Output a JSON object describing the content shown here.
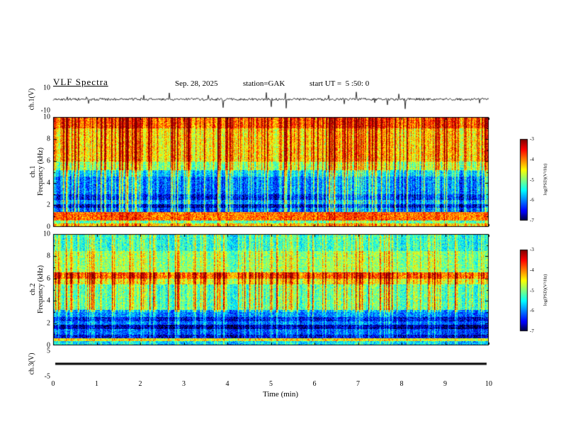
{
  "header": {
    "title": "VLF Spectra",
    "date": "Sep. 28, 2025",
    "station": "station=GAK",
    "start_ut": "start UT =  5 :50: 0"
  },
  "chart_data": {
    "type": "heatmap",
    "title": "VLF Spectra",
    "xlabel": "Time (min)",
    "x_range": [
      0,
      10
    ],
    "x_ticks": [
      0,
      1,
      2,
      3,
      4,
      5,
      6,
      7,
      8,
      9,
      10
    ],
    "panels": [
      {
        "id": "ch1-waveform",
        "plot": "line",
        "ylabel": "ch.1(V)",
        "y_range": [
          -10,
          10
        ],
        "y_tick_labels": [
          10,
          -10
        ],
        "description": "Broadband receiver output: continuous noise of roughly +/-1 V around 0 V with many impulsive sferic spikes reaching +/-4 to 8 V throughout the 10 minutes"
      },
      {
        "id": "ch1-spectrogram",
        "plot": "heatmap",
        "channel_label": "ch.1",
        "ylabel": "Frequency (kHz)",
        "y_range": [
          0,
          10
        ],
        "y_tick_labels": [
          0,
          2,
          4,
          6,
          8,
          10
        ],
        "psd_range": [
          -7,
          -3
        ],
        "features": [
          "dense vertical broadband striping (sferics) across 1-10 kHz, strongest 5-10 kHz reaching -3 (red/orange)",
          "background near -4.9 (yellow/green) from 6-10 kHz",
          "blue background about -6 to -6.5 between 3 and 5 kHz crossed by colorful stripes",
          "dark quiet bands (about -7, near black) around 1.8-2.0 and 2.5-3.0 kHz",
          "bright persistent band about -4 (yellow/orange/red) near 0.6-1.4 kHz and at the bottom edge"
        ]
      },
      {
        "id": "ch2-spectrogram",
        "plot": "heatmap",
        "channel_label": "ch.2",
        "ylabel": "Frequency (kHz)",
        "y_range": [
          0,
          10
        ],
        "y_tick_labels": [
          0,
          2,
          4,
          6,
          8,
          10
        ],
        "psd_range": [
          -7,
          -3
        ],
        "features": [
          "green/cyan background about -5.5 with vertical sferic striping over the whole band",
          "persistent yellow-orange horizontal band about -4.3 near 6.0-6.5 kHz",
          "darker blue region 1-3 kHz with near-black quiet bands (about -7) around 1.5-1.9 kHz",
          "thin bright band about -4.7 near 0.4-0.7 kHz"
        ]
      },
      {
        "id": "ch3-waveform",
        "plot": "line",
        "ylabel": "ch.3(V)",
        "y_range": [
          -5,
          5
        ],
        "y_tick_labels": [
          5,
          -5
        ],
        "description": "Constant flat trace at 0 V for the full 10 minutes (channel inactive)"
      }
    ],
    "colorbar": {
      "label": "log(PSD)(V²/Hz)",
      "range": [
        -7,
        -3
      ],
      "ticks": [
        -3,
        -4,
        -5,
        -6,
        -7
      ],
      "colormap": "jet"
    }
  }
}
